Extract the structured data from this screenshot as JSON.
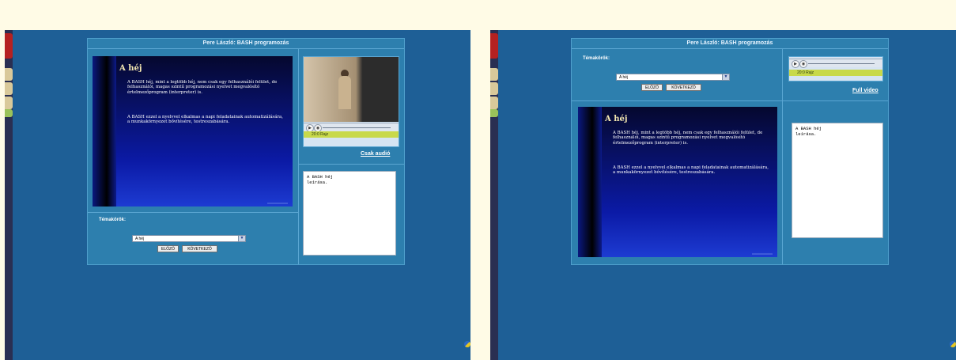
{
  "header": {
    "title": "Pere László: BASH programozás"
  },
  "slide": {
    "heading": "A héj",
    "paragraph1": "A BASH héj, mint a legtöbb héj, nem csak egy felhasználói felület, de felhasználói, magas szintű programozási nyelvet megvalósító értelmezőprogram (interpreter) is.",
    "paragraph2": "A BASH ezzel a nyelvvel elkalmas a napi feladatainak automatizálására, a munkakörnyezet bővítésére, testreszabására."
  },
  "player": {
    "status_text": "20:0 Rajz"
  },
  "links": {
    "audio_only": "Csak audió",
    "full_video": "Full video"
  },
  "notes": {
    "line1": "A BASH héj",
    "line2": "leírása."
  },
  "topics": {
    "label": "Témakörök:",
    "selected": "A héj"
  },
  "buttons": {
    "prev": "ELŐZŐ",
    "next": "KÖVETKEZŐ"
  },
  "icons": {
    "play": "play-icon",
    "volume": "volume-icon",
    "dropdown": "chevron-down-icon"
  }
}
